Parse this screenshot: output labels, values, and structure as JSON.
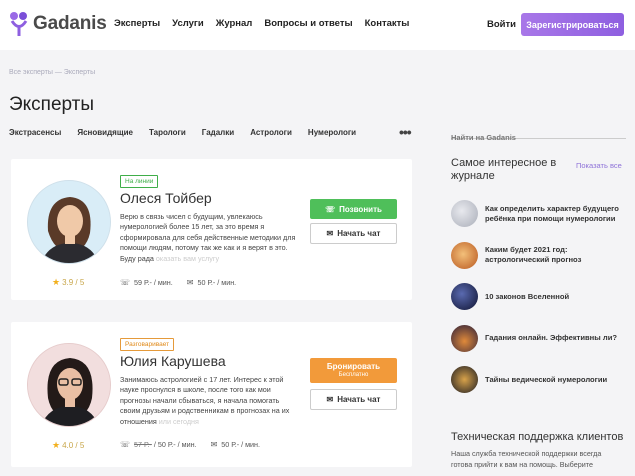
{
  "header": {
    "logo_text": "Gadanis",
    "nav": [
      "Эксперты",
      "Услуги",
      "Журнал",
      "Вопросы и ответы",
      "Контакты"
    ],
    "login": "Войти",
    "register": "Зарегистрироваться"
  },
  "breadcrumb": {
    "home": "Все эксперты",
    "sep": "—",
    "current": "Эксперты"
  },
  "page_title": "Эксперты",
  "categories": [
    "Экстрасенсы",
    "Ясновидящие",
    "Тарологи",
    "Гадалки",
    "Астрологи",
    "Нумерологи"
  ],
  "more": "•••",
  "experts": [
    {
      "status": "На линии",
      "name": "Олеся Тойбер",
      "bio": "Верю в связь чисел с будущим, увлекаюсь нумерологией более 15 лет, за это время я сформировала для себя действенные методики для помощи людям, потому так же как и я верят в это. Буду рада ",
      "bio_fade": "оказать вам услугу",
      "rating": "3.9 / 5",
      "price_voice": "59 Р.- / мин.",
      "price_chat": "50 Р.- / мин.",
      "primary_button": "Позвонить",
      "chat_button": "Начать чат"
    },
    {
      "status": "Разговаривает",
      "name": "Юлия Карушева",
      "bio": "Занимаюсь астрологией с 17 лет. Интерес к этой науке проснулся в школе, после того как мои прогнозы начали сбываться, я начала помогать своим друзьям и родственникам в прогнозах на их отношения ",
      "bio_fade": "или сегодня",
      "rating": "4.0 / 5",
      "price_old": "57 Р.-",
      "price_voice": "50 Р.- / мин.",
      "price_chat": "50 Р.- / мин.",
      "primary_button": "Бронировать",
      "primary_sub": "Бесплатно",
      "chat_button": "Начать чат"
    }
  ],
  "sidebar": {
    "search_placeholder": "Найти на Gadanis",
    "title": "Самое интересное в журнале",
    "show_all": "Показать все",
    "articles": [
      {
        "title": "Как определить характер будущего ребёнка при помощи нумерологии",
        "color": "#c9cdd6"
      },
      {
        "title": "Каким будет 2021 год: астрологический прогноз",
        "color": "#d98a3a"
      },
      {
        "title": "10 законов Вселенной",
        "color": "#1c2240"
      },
      {
        "title": "Гадания онлайн. Эффективны ли?",
        "color": "#3a2a4a"
      },
      {
        "title": "Тайны ведической нумерологии",
        "color": "#2a2a30"
      }
    ],
    "support_title": "Техническая поддержка клиентов",
    "support_text": "Наша служба технической поддержки всегда готова прийти к вам на помощь. Выберите"
  },
  "colors": {
    "accent": "#8e5fe0",
    "call": "#4fbf5a",
    "book": "#f29a3a",
    "star": "#f2b01e"
  }
}
